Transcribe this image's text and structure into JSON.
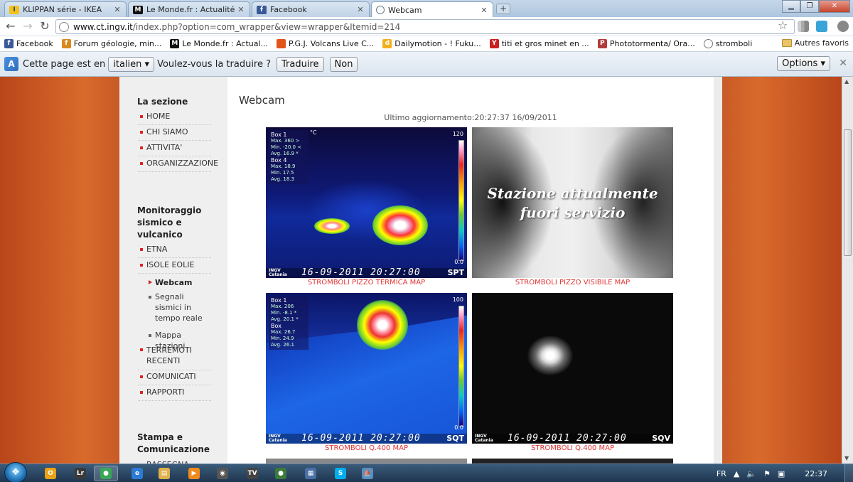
{
  "tabs": [
    {
      "label": "KLIPPAN série - IKEA",
      "icon": "ikea-icon",
      "color": "#f2c318"
    },
    {
      "label": "Le Monde.fr : Actualité à la",
      "icon": "lemonde-icon",
      "color": "#111111"
    },
    {
      "label": "Facebook",
      "icon": "facebook-icon",
      "color": "#3b5998"
    },
    {
      "label": "Webcam",
      "icon": "globe-icon",
      "color": "#6a7a88"
    }
  ],
  "toolbar": {
    "url_host": "www.ct.ingv.it",
    "url_path": "/index.php?option=com_wrapper&view=wrapper&Itemid=214"
  },
  "bookmarks": [
    {
      "label": "Facebook",
      "icon": "facebook-icon",
      "color": "#3b5998",
      "glyph": "f"
    },
    {
      "label": "Forum géologie, min...",
      "icon": "forum-icon",
      "color": "#d98a1d",
      "glyph": "f"
    },
    {
      "label": "Le Monde.fr : Actual...",
      "icon": "lemonde-icon",
      "color": "#111111",
      "glyph": "M"
    },
    {
      "label": "P.G.J. Volcans Live C...",
      "icon": "pgj-icon",
      "color": "#e2541a",
      "glyph": ""
    },
    {
      "label": "Dailymotion - ! Fuku...",
      "icon": "dailymotion-icon",
      "color": "#f2b01e",
      "glyph": "d"
    },
    {
      "label": "titi et gros minet en ...",
      "icon": "youtube-icon",
      "color": "#cc1f1f",
      "glyph": "Y"
    },
    {
      "label": "Phototormenta/ Ora...",
      "icon": "phototormenta-icon",
      "color": "#b23a3a",
      "glyph": "P"
    },
    {
      "label": "stromboli",
      "icon": "globe-icon",
      "color": "#777777",
      "glyph": ""
    }
  ],
  "bookmarks_other": "Autres favoris",
  "translate": {
    "prefix": "Cette page est en",
    "language": "italien",
    "question": "Voulez-vous la traduire ?",
    "translate_btn": "Traduire",
    "no_btn": "Non",
    "options_btn": "Options"
  },
  "sidebar": {
    "section1_title": "La sezione",
    "section1_items": [
      "HOME",
      "CHI SIAMO",
      "ATTIVITA'",
      "ORGANIZZAZIONE"
    ],
    "section2_title": "Monitoraggio sismico e vulcanico",
    "section2_items": [
      "ETNA",
      "ISOLE EOLIE"
    ],
    "sub_items": [
      "Webcam",
      "Segnali sismici in tempo reale",
      "Mappa stazioni"
    ],
    "section2_items_after": [
      "TERREMOTI RECENTI",
      "COMUNICATI",
      "RAPPORTI"
    ],
    "section3_title": "Stampa e Comunicazione",
    "section3_partial": "RASSEGNA"
  },
  "content": {
    "title": "Webcam",
    "last_update": "Ultimo aggiornamento:20:27:37 16/09/2011",
    "cams": [
      {
        "caption": "STROMBOLI PIZZO TERMICA MAP",
        "type": "thermal",
        "scale_max": "120",
        "scale_min": "0.0",
        "unit": "°C",
        "box_a": "Box 1",
        "box_a_lines": [
          "Max. 360 >",
          "Min. -20.0 <",
          "Avg. 16.9 *"
        ],
        "box_b": "Box 4",
        "box_b_lines": [
          "Max. 18.9",
          "Min. 17.5",
          "Avg. 18.3"
        ],
        "stamp": "16-09-2011 20:27:00",
        "code": "SPT"
      },
      {
        "caption": "STROMBOLI PIZZO VISIBILE MAP",
        "type": "offline",
        "offline_text_1": "Stazione attualmente",
        "offline_text_2": "fuori servizio"
      },
      {
        "caption": "STROMBOLI Q.400 MAP",
        "type": "thermal",
        "scale_max": "100",
        "scale_min": "0.0",
        "unit": "",
        "box_a": "Box 1",
        "box_a_lines": [
          "Max. 206",
          "Min. -8.1 *",
          "Avg. 20.1 *"
        ],
        "box_b": "Box",
        "box_b_lines": [
          "Max. 26.7",
          "Min. 24.9",
          "Avg. 26.1"
        ],
        "stamp": "16-09-2011 20:27:00",
        "code": "SQT"
      },
      {
        "caption": "STROMBOLI Q.400 MAP",
        "type": "visible",
        "stamp": "16-09-2011 20:27:00",
        "code": "SQV"
      }
    ],
    "logo_text_1": "INGV",
    "logo_text_2": "Catania"
  },
  "taskbar": {
    "apps": [
      {
        "name": "outlook-icon",
        "color": "#e8a317",
        "glyph": "O"
      },
      {
        "name": "lightroom-icon",
        "color": "#3a3a3a",
        "glyph": "Lr"
      },
      {
        "name": "chrome-icon",
        "color": "#3aa657",
        "glyph": "●"
      },
      {
        "name": "ie-icon",
        "color": "#2b7bd6",
        "glyph": "e"
      },
      {
        "name": "explorer-icon",
        "color": "#e1b04a",
        "glyph": "▤"
      },
      {
        "name": "media-player-icon",
        "color": "#f08a1c",
        "glyph": "▶"
      },
      {
        "name": "cyberlink-icon",
        "color": "#555555",
        "glyph": "◉"
      },
      {
        "name": "tv-icon",
        "color": "#444444",
        "glyph": "TV"
      },
      {
        "name": "app-orb-icon",
        "color": "#3b7a3b",
        "glyph": "●"
      },
      {
        "name": "calculator-icon",
        "color": "#4a6fa5",
        "glyph": "▦"
      },
      {
        "name": "skype-icon",
        "color": "#00aff0",
        "glyph": "S"
      },
      {
        "name": "boat-icon",
        "color": "#5a8fbf",
        "glyph": "⛵"
      }
    ],
    "lang": "FR",
    "time": "22:37"
  }
}
